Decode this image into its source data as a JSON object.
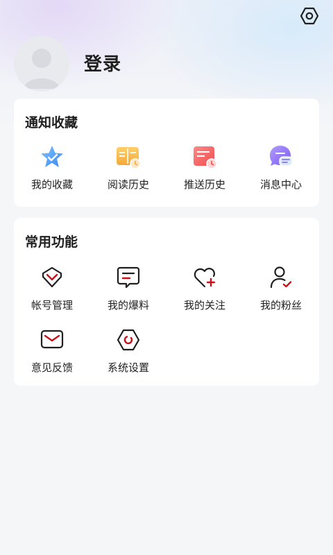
{
  "profile": {
    "login_label": "登录"
  },
  "notify": {
    "title": "通知收藏",
    "items": [
      {
        "label": "我的收藏",
        "icon": "star-icon"
      },
      {
        "label": "阅读历史",
        "icon": "book-clock-icon"
      },
      {
        "label": "推送历史",
        "icon": "calendar-clock-icon"
      },
      {
        "label": "消息中心",
        "icon": "chat-bubble-icon"
      }
    ]
  },
  "common": {
    "title": "常用功能",
    "items": [
      {
        "label": "帐号管理",
        "icon": "account-shield-icon"
      },
      {
        "label": "我的爆料",
        "icon": "comment-icon"
      },
      {
        "label": "我的关注",
        "icon": "heart-plus-icon"
      },
      {
        "label": "我的粉丝",
        "icon": "user-check-icon"
      },
      {
        "label": "意见反馈",
        "icon": "mail-icon"
      },
      {
        "label": "系统设置",
        "icon": "settings-hexagon-icon"
      }
    ]
  },
  "colors": {
    "accent": "#c8101a",
    "outline": "#1f1f1f"
  }
}
